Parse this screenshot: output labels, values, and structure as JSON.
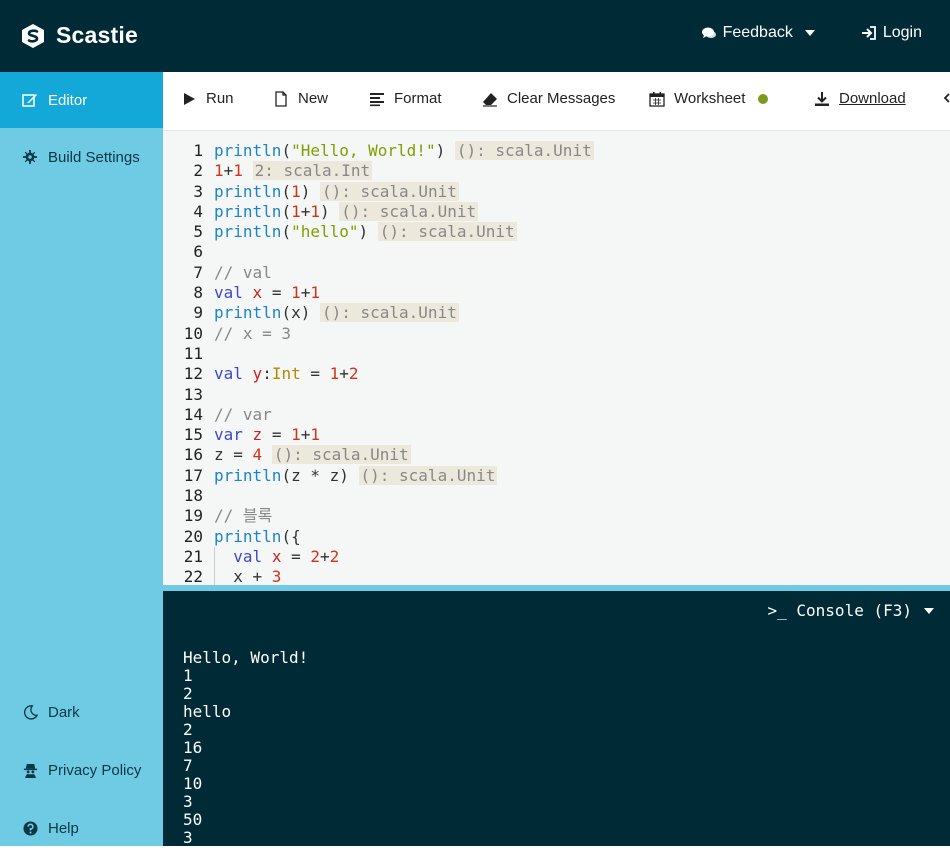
{
  "app": {
    "name": "Scastie"
  },
  "topbar": {
    "feedback": "Feedback",
    "login": "Login"
  },
  "sidebar": {
    "editor": "Editor",
    "build_settings": "Build Settings",
    "dark": "Dark",
    "privacy": "Privacy Policy",
    "help": "Help"
  },
  "toolbar": {
    "run": "Run",
    "new": "New",
    "format": "Format",
    "clear": "Clear Messages",
    "worksheet": "Worksheet",
    "download": "Download"
  },
  "editor": {
    "lines": [
      "1",
      "2",
      "3",
      "4",
      "5",
      "6",
      "7",
      "8",
      "9",
      "10",
      "11",
      "12",
      "13",
      "14",
      "15",
      "16",
      "17",
      "18",
      "19",
      "20",
      "21",
      "22"
    ],
    "annotations": {
      "l1": "(): scala.Unit",
      "l2": "2: scala.Int",
      "l3": "(): scala.Unit",
      "l4": "(): scala.Unit",
      "l5": "(): scala.Unit",
      "l9": "(): scala.Unit",
      "l16": "(): scala.Unit",
      "l17": "(): scala.Unit"
    },
    "tokens": {
      "println": "println",
      "hello_world": "\"Hello, World!\"",
      "hello": "\"hello\"",
      "c_val": "// val",
      "c_x3": "// x = 3",
      "c_var": "// var",
      "c_block": "// 블록",
      "kw_val": "val",
      "kw_var": "var",
      "type_int": "Int"
    }
  },
  "console": {
    "title": ">_ Console (F3)",
    "output": "Hello, World!\n1\n2\nhello\n2\n16\n7\n10\n3\n50\n3"
  }
}
